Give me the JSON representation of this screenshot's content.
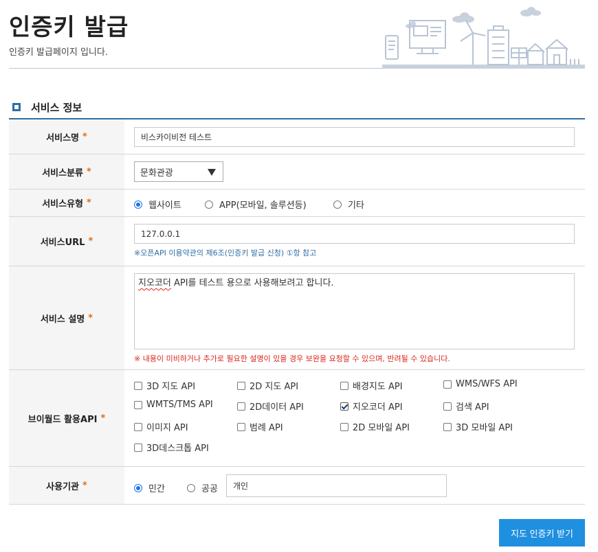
{
  "header": {
    "title": "인증키 발급",
    "subtitle": "인증키 발급페이지 입니다."
  },
  "section": {
    "title": "서비스 정보"
  },
  "required_mark": "*",
  "form": {
    "service_name": {
      "label": "서비스명",
      "value": "비스카이비전 테스트"
    },
    "service_category": {
      "label": "서비스분류",
      "selected": "문화관광"
    },
    "service_type": {
      "label": "서비스유형",
      "options": [
        "웹사이트",
        "APP(모바일, 솔루션등)",
        "기타"
      ],
      "selected_index": 0
    },
    "service_url": {
      "label": "서비스URL",
      "value": "127.0.0.1",
      "note": "※오픈API 이용약관의 제6조(인증키 발급 신청) ①항 참고"
    },
    "service_desc": {
      "label": "서비스 설명",
      "value_part1": "지오코더",
      "value_part2": " API를 테스트 용으로 사용해보려고 합니다.",
      "note": "※ 내용이 미비하거나 추가로 필요한 설명이 있을 경우 보완을 요청할 수 있으며, 반려될 수 있습니다."
    },
    "api": {
      "label": "브이월드 활용API",
      "items": [
        {
          "label": "3D 지도 API",
          "checked": false
        },
        {
          "label": "2D 지도 API",
          "checked": false
        },
        {
          "label": "배경지도 API",
          "checked": false
        },
        {
          "label": "WMS/WFS API",
          "checked": false
        },
        {
          "label": "WMTS/TMS API",
          "checked": false
        },
        {
          "label": "2D데이터 API",
          "checked": false
        },
        {
          "label": "지오코더 API",
          "checked": true
        },
        {
          "label": "검색 API",
          "checked": false
        },
        {
          "label": "이미지 API",
          "checked": false
        },
        {
          "label": "범례 API",
          "checked": false
        },
        {
          "label": "2D 모바일 API",
          "checked": false
        },
        {
          "label": "3D 모바일 API",
          "checked": false
        },
        {
          "label": "3D데스크톱 API",
          "checked": false
        }
      ]
    },
    "org": {
      "label": "사용기관",
      "options": [
        "민간",
        "공공"
      ],
      "selected_index": 0,
      "value": "개인"
    }
  },
  "submit_label": "지도 인증키 받기",
  "colors": {
    "accent": "#1f8fe0",
    "section_line": "#2e6da4",
    "required": "#e06d13",
    "note_red": "#d9261c",
    "note_blue": "#2e6da4"
  }
}
